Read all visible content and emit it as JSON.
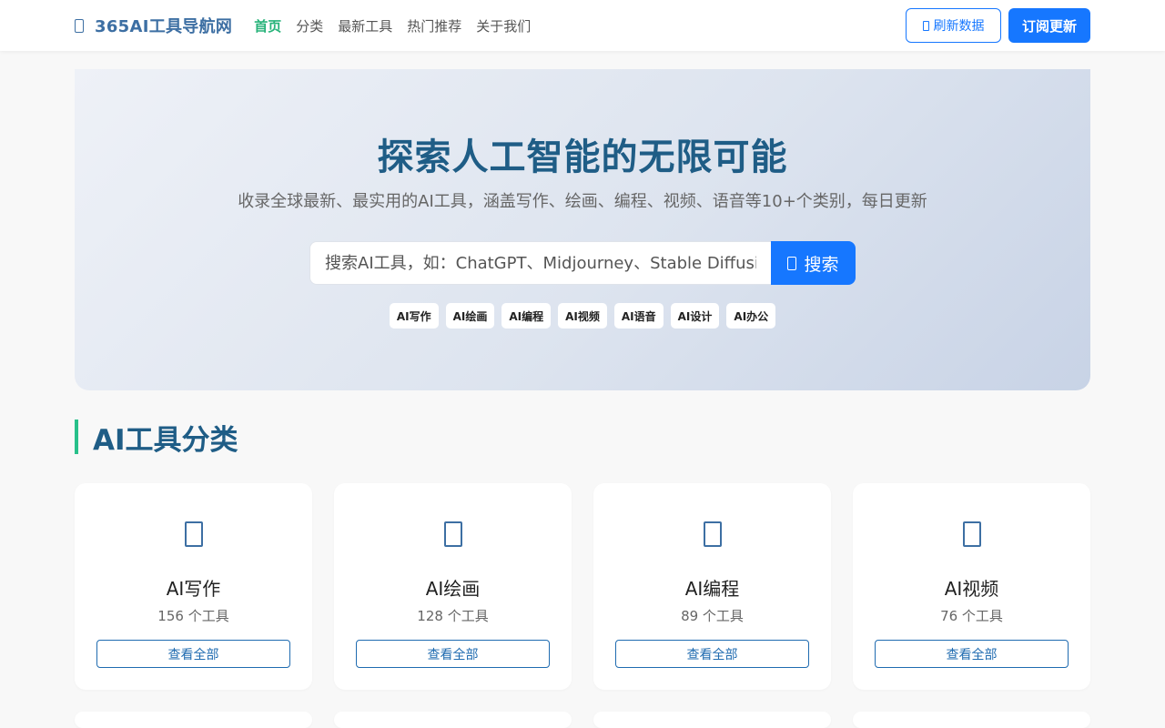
{
  "header": {
    "logo_text": "365AI工具导航网",
    "nav": [
      {
        "label": "首页",
        "active": true
      },
      {
        "label": "分类",
        "active": false
      },
      {
        "label": "最新工具",
        "active": false
      },
      {
        "label": "热门推荐",
        "active": false
      },
      {
        "label": "关于我们",
        "active": false
      }
    ],
    "refresh_label": "刷新数据",
    "subscribe_label": "订阅更新"
  },
  "hero": {
    "title": "探索人工智能的无限可能",
    "subtitle": "收录全球最新、最实用的AI工具，涵盖写作、绘画、编程、视频、语音等10+个类别，每日更新",
    "search_placeholder": "搜索AI工具，如：ChatGPT、Midjourney、Stable Diffusion...",
    "search_button": "搜索",
    "tags": [
      "AI写作",
      "AI绘画",
      "AI编程",
      "AI视频",
      "AI语音",
      "AI设计",
      "AI办公"
    ]
  },
  "categories_section": {
    "title": "AI工具分类",
    "cards": [
      {
        "name": "AI写作",
        "count": "156 个工具",
        "button": "查看全部"
      },
      {
        "name": "AI绘画",
        "count": "128 个工具",
        "button": "查看全部"
      },
      {
        "name": "AI编程",
        "count": "89 个工具",
        "button": "查看全部"
      },
      {
        "name": "AI视频",
        "count": "76 个工具",
        "button": "查看全部"
      }
    ]
  },
  "colors": {
    "brand_blue": "#1677ff",
    "accent_green": "#28b37a",
    "title_blue": "#1f5d86",
    "logo_blue": "#3d6fa3"
  }
}
